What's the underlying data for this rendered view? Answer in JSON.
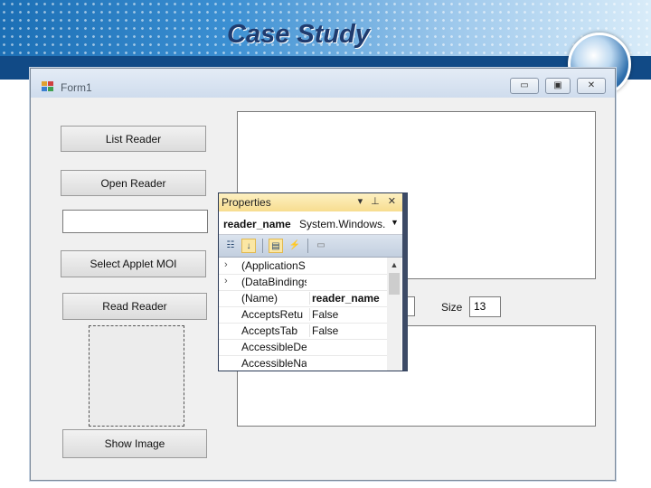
{
  "slide": {
    "title": "Case Study"
  },
  "form": {
    "title": "Form1",
    "window_buttons": {
      "minimize": "▭",
      "maximize": "▣",
      "close": "✕"
    },
    "buttons": {
      "list_reader": "List Reader",
      "open_reader": "Open Reader",
      "select_applet": "Select Applet MOI",
      "read_reader": "Read Reader",
      "show_image": "Show Image"
    },
    "reader_textbox": {
      "value": ""
    },
    "size_label": "Size",
    "size_value": "13"
  },
  "properties": {
    "title": "Properties",
    "title_icons": "▾ ⊥ ✕",
    "object_name": "reader_name",
    "object_type": "System.Windows.",
    "rows": [
      {
        "expander": "›",
        "name": "(ApplicationS",
        "value": "",
        "bold": false
      },
      {
        "expander": "›",
        "name": "(DataBindings",
        "value": "",
        "bold": false
      },
      {
        "expander": "",
        "name": "(Name)",
        "value": "reader_name",
        "bold": true
      },
      {
        "expander": "",
        "name": "AcceptsRetu",
        "value": "False",
        "bold": false
      },
      {
        "expander": "",
        "name": "AcceptsTab",
        "value": "False",
        "bold": false
      },
      {
        "expander": "",
        "name": "AccessibleDe",
        "value": "",
        "bold": false
      },
      {
        "expander": "",
        "name": "AccessibleNa",
        "value": "",
        "bold": false
      }
    ]
  },
  "colors": {
    "banner_dark": "#114a86",
    "title_text": "#1f3b6e",
    "properties_header": "#f7dd8f"
  }
}
